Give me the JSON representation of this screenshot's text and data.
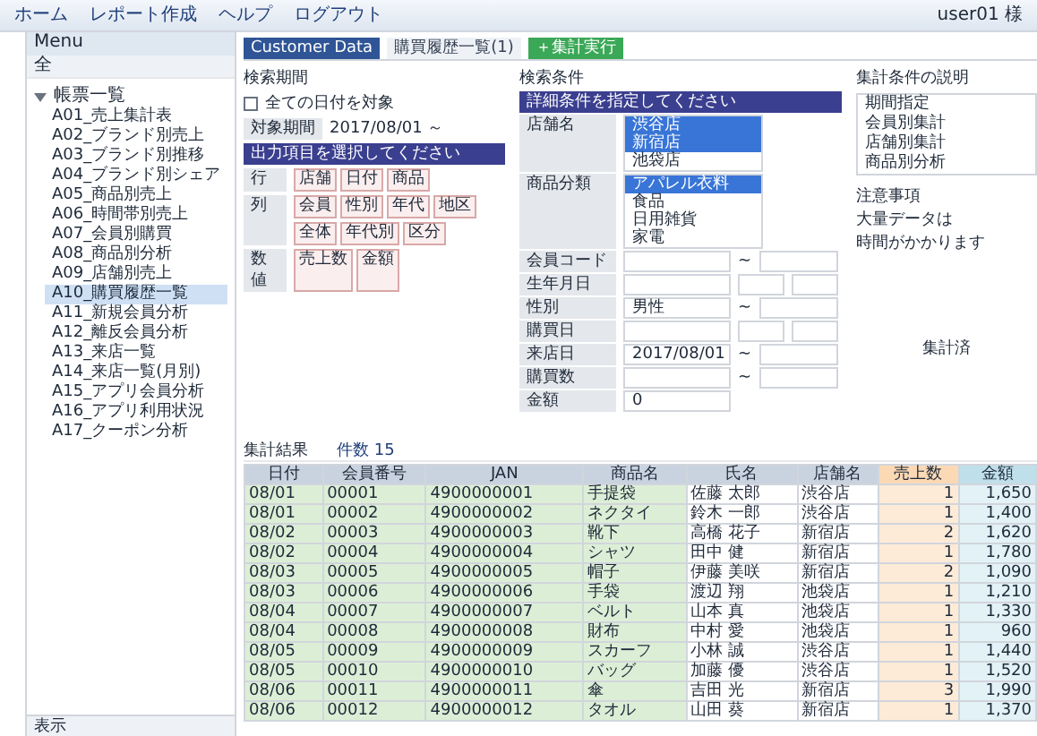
{
  "toolbar": {
    "items": [
      "ホーム",
      "レポート作成",
      "ヘルプ",
      "ログアウト"
    ],
    "user": "user01 様"
  },
  "tree": {
    "title": "Menu",
    "search": "全",
    "root": {
      "label": "帳票一覧",
      "expanded": true,
      "children": [
        {
          "label": "A01_売上集計表",
          "selected": false
        },
        {
          "label": "A02_ブランド別売上",
          "selected": false
        },
        {
          "label": "A03_ブランド別推移",
          "selected": false
        },
        {
          "label": "A04_ブランド別シェア",
          "selected": false
        },
        {
          "label": "A05_商品別売上",
          "selected": false
        },
        {
          "label": "A06_時間帯別売上",
          "selected": false
        },
        {
          "label": "A07_会員別購買",
          "selected": false
        },
        {
          "label": "A08_商品別分析",
          "selected": false
        },
        {
          "label": "A09_店舗別売上",
          "selected": false
        },
        {
          "label": "A10_購買履歴一覧",
          "selected": true
        },
        {
          "label": "A11_新規会員分析",
          "selected": false
        },
        {
          "label": "A12_離反会員分析",
          "selected": false
        },
        {
          "label": "A13_来店一覧",
          "selected": false
        },
        {
          "label": "A14_来店一覧(月別)",
          "selected": false
        },
        {
          "label": "A15_アプリ会員分析",
          "selected": false
        },
        {
          "label": "A16_アプリ利用状況",
          "selected": false
        },
        {
          "label": "A17_クーポン分析",
          "selected": false
        }
      ]
    }
  },
  "status_bar": "表示",
  "tabs": [
    {
      "label": "Customer Data",
      "selected": true
    },
    {
      "label": "購買履歴一覧(1)",
      "selected": false
    }
  ],
  "run_button": "＋集計実行",
  "period": {
    "label": "検索期間"
  },
  "all_dates": {
    "label": "全ての日付を対象",
    "checked": false
  },
  "store": {
    "label": "対象期間",
    "value": "2017/08/01 ～"
  },
  "output": {
    "title": "出力項目を選択してください",
    "rows": [
      {
        "label": "行",
        "chips": [
          "店舗",
          "日付",
          "商品"
        ]
      },
      {
        "label": "列",
        "chips": [
          "会員",
          "性別",
          "年代",
          "地区",
          "全体",
          "年代別",
          "区分"
        ]
      },
      {
        "label": "数値",
        "chips": [
          "売上数",
          "金額"
        ]
      }
    ]
  },
  "conditions": {
    "caption": "検索条件",
    "title": "詳細条件を指定してください",
    "lists": [
      {
        "label": "店舗名",
        "options": [
          {
            "label": "渋谷店",
            "selected": true
          },
          {
            "label": "新宿店",
            "selected": true
          },
          {
            "label": "池袋店",
            "selected": false
          }
        ]
      },
      {
        "label": "商品分類",
        "options": [
          {
            "label": "アパレル衣料",
            "selected": true
          },
          {
            "label": "食品",
            "selected": false
          },
          {
            "label": "日用雑貨",
            "selected": false
          },
          {
            "label": "家電",
            "selected": false
          }
        ]
      }
    ],
    "fields": [
      {
        "label": "会員コード",
        "kind": "range",
        "separator": "~"
      },
      {
        "label": "生年月日",
        "kind": "triple"
      },
      {
        "label": "性別",
        "kind": "range",
        "value": "男性",
        "separator": "~"
      },
      {
        "label": "購買日",
        "kind": "triple"
      },
      {
        "label": "来店日",
        "kind": "range",
        "value": "2017/08/01",
        "separator": "~"
      },
      {
        "label": "購買数",
        "kind": "range",
        "separator": "~"
      },
      {
        "label": "金額",
        "kind": "single",
        "value": "0"
      }
    ]
  },
  "notes": {
    "title": "集計条件の説明",
    "lines": [
      "期間指定",
      "会員別集計",
      "店舗別集計",
      "商品別分析"
    ]
  },
  "caution": {
    "title": "注意事項",
    "lines": [
      "大量データは",
      "時間がかかります"
    ]
  },
  "state": "集計済",
  "results": {
    "title": "集計結果",
    "count": "件数 15",
    "columns": [
      "日付",
      "会員番号",
      "JAN",
      "商品名",
      "氏名",
      "店舗名",
      "売上数",
      "金額"
    ],
    "rows": [
      [
        "08/01",
        "00001",
        "4900000001",
        "手提袋",
        "佐藤 太郎",
        "渋谷店",
        "1",
        "1,650"
      ],
      [
        "08/01",
        "00002",
        "4900000002",
        "ネクタイ",
        "鈴木 一郎",
        "渋谷店",
        "1",
        "1,400"
      ],
      [
        "08/02",
        "00003",
        "4900000003",
        "靴下",
        "高橋 花子",
        "新宿店",
        "2",
        "1,620"
      ],
      [
        "08/02",
        "00004",
        "4900000004",
        "シャツ",
        "田中 健",
        "新宿店",
        "1",
        "1,780"
      ],
      [
        "08/03",
        "00005",
        "4900000005",
        "帽子",
        "伊藤 美咲",
        "新宿店",
        "2",
        "1,090"
      ],
      [
        "08/03",
        "00006",
        "4900000006",
        "手袋",
        "渡辺 翔",
        "池袋店",
        "1",
        "1,210"
      ],
      [
        "08/04",
        "00007",
        "4900000007",
        "ベルト",
        "山本 真",
        "池袋店",
        "1",
        "1,330"
      ],
      [
        "08/04",
        "00008",
        "4900000008",
        "財布",
        "中村 愛",
        "池袋店",
        "1",
        "960"
      ],
      [
        "08/05",
        "00009",
        "4900000009",
        "スカーフ",
        "小林 誠",
        "渋谷店",
        "1",
        "1,440"
      ],
      [
        "08/05",
        "00010",
        "4900000010",
        "バッグ",
        "加藤 優",
        "渋谷店",
        "1",
        "1,520"
      ],
      [
        "08/06",
        "00011",
        "4900000011",
        "傘",
        "吉田 光",
        "新宿店",
        "3",
        "1,990"
      ],
      [
        "08/06",
        "00012",
        "4900000012",
        "タオル",
        "山田 葵",
        "新宿店",
        "1",
        "1,370"
      ]
    ]
  }
}
